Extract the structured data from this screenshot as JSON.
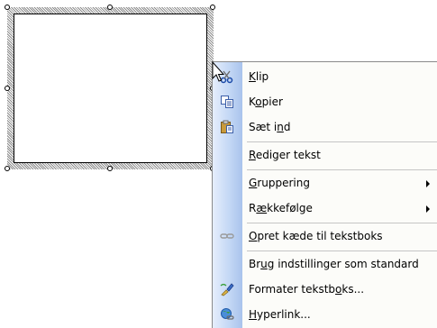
{
  "context_menu": {
    "items": [
      {
        "label": "Klip",
        "pre": "",
        "key": "K",
        "post": "lip",
        "icon": "scissors-icon",
        "submenu": false
      },
      {
        "label": "Kopier",
        "pre": "K",
        "key": "o",
        "post": "pier",
        "icon": "copy-icon",
        "submenu": false
      },
      {
        "label": "Sæt ind",
        "pre": "Sæt i",
        "key": "n",
        "post": "d",
        "icon": "paste-icon",
        "submenu": false
      },
      {
        "label": "Rediger tekst",
        "pre": "",
        "key": "R",
        "post": "ediger tekst",
        "icon": "",
        "submenu": false
      },
      {
        "label": "Gruppering",
        "pre": "",
        "key": "G",
        "post": "ruppering",
        "icon": "",
        "submenu": true
      },
      {
        "label": "Rækkefølge",
        "pre": "R",
        "key": "æ",
        "post": "kkefølge",
        "icon": "",
        "submenu": true
      },
      {
        "label": "Opret kæde til tekstboks",
        "pre": "",
        "key": "O",
        "post": "pret kæde til tekstboks",
        "icon": "link-icon",
        "submenu": false
      },
      {
        "label": "Brug indstillinger som standard",
        "pre": "Br",
        "key": "u",
        "post": "g indstillinger som standard",
        "icon": "",
        "submenu": false
      },
      {
        "label": "Formater tekstboks...",
        "pre": "Formater tekstb",
        "key": "o",
        "post": "ks...",
        "icon": "format-icon",
        "submenu": false
      },
      {
        "label": "Hyperlink...",
        "pre": "",
        "key": "H",
        "post": "yperlink...",
        "icon": "hyperlink-icon",
        "submenu": false
      }
    ]
  }
}
